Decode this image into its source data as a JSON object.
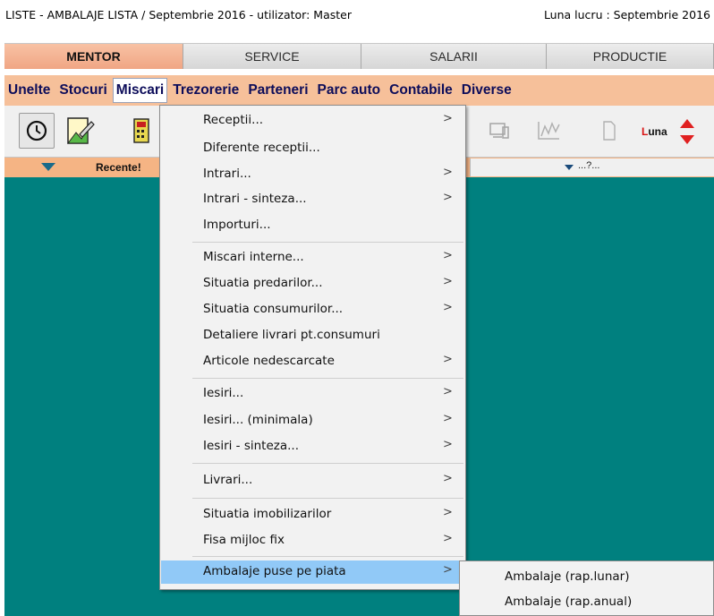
{
  "window": {
    "title": "LISTE - AMBALAJE LISTA / Septembrie 2016 - utilizator: Master",
    "working_month": "Luna lucru : Septembrie 2016"
  },
  "module_tabs": [
    {
      "label": "MENTOR",
      "active": true
    },
    {
      "label": "SERVICE",
      "active": false
    },
    {
      "label": "SALARII",
      "active": false
    },
    {
      "label": "PRODUCTIE",
      "active": false
    }
  ],
  "menubar": [
    {
      "label": "Unelte"
    },
    {
      "label": "Stocuri"
    },
    {
      "label": "Miscari",
      "active": true
    },
    {
      "label": "Trezorerie"
    },
    {
      "label": "Parteneri"
    },
    {
      "label": "Parc auto"
    },
    {
      "label": "Contabile"
    },
    {
      "label": "Diverse"
    }
  ],
  "toolbar": {
    "icons": [
      "clock-icon",
      "edit-document-icon",
      "calculator-icon",
      "computer-icon",
      "chart-icon",
      "page-icon",
      "spin-arrows-icon"
    ],
    "luna_first_letter": "L",
    "luna_rest": "una"
  },
  "recent_bar": {
    "label": "Recente!",
    "field_text": "...?..."
  },
  "dropdown": {
    "items": [
      {
        "label": "Receptii...",
        "submenu": true
      },
      {
        "label": "Diferente receptii...",
        "submenu": false
      },
      {
        "label": "Intrari...",
        "submenu": true
      },
      {
        "label": "Intrari - sinteza...",
        "submenu": true
      },
      {
        "label": "Importuri...",
        "submenu": false
      },
      {
        "label": "Miscari interne...",
        "submenu": true
      },
      {
        "label": "Situatia predarilor...",
        "submenu": true
      },
      {
        "label": "Situatia consumurilor...",
        "submenu": true
      },
      {
        "label": "Detaliere livrari pt.consumuri",
        "submenu": false
      },
      {
        "label": "Articole nedescarcate",
        "submenu": true
      },
      {
        "label": "Iesiri...",
        "submenu": true
      },
      {
        "label": "Iesiri...  (minimala)",
        "submenu": true
      },
      {
        "label": "Iesiri - sinteza...",
        "submenu": true
      },
      {
        "label": "Livrari...",
        "submenu": true
      },
      {
        "label": "Situatia imobilizarilor",
        "submenu": true
      },
      {
        "label": "Fisa mijloc fix",
        "submenu": true
      },
      {
        "label": "Ambalaje puse pe piata",
        "submenu": true,
        "highlighted": true
      }
    ],
    "arrow_glyph": ">"
  },
  "submenu": {
    "items": [
      "Ambalaje (rap.lunar)",
      "Ambalaje (rap.anual)"
    ]
  },
  "colors": {
    "menubar_bg": "#f6c09a",
    "active_tab": "#f0a684",
    "workspace": "#00807f",
    "highlight": "#91c9f7",
    "menu_text": "#0d0d5a"
  }
}
